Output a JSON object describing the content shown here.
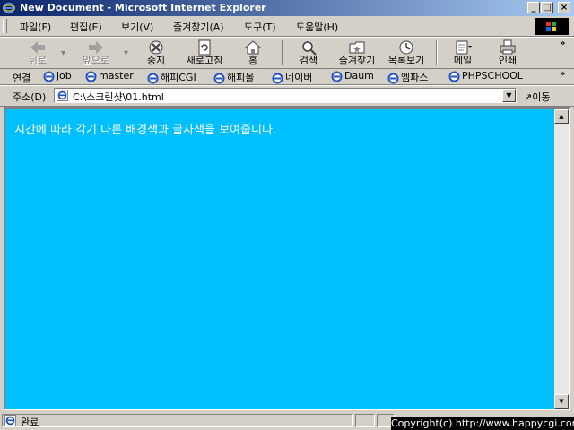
{
  "window": {
    "title": "New Document - Microsoft Internet Explorer"
  },
  "menu": [
    "파일(F)",
    "편집(E)",
    "보기(V)",
    "즐겨찾기(A)",
    "도구(T)",
    "도움말(H)"
  ],
  "toolbar": {
    "back": "뒤로",
    "forward": "앞으로",
    "stop": "중지",
    "refresh": "새로고침",
    "home": "홈",
    "search": "검색",
    "favorites": "즐겨찾기",
    "history": "목록보기",
    "mail": "메일",
    "print": "인쇄"
  },
  "links": {
    "label": "연결",
    "items": [
      "job",
      "master",
      "해피CGI",
      "해피몰",
      "네이버",
      "Daum",
      "엠파스",
      "PHPSCHOOL"
    ]
  },
  "address": {
    "label": "주소(D)",
    "url": "C:\\스크린샷\\01.html",
    "go": "이동"
  },
  "page": {
    "message": "시간에 따라 각기 다른 배경색과 글자색을 보여줍니다.",
    "background_color": "#00bfff",
    "text_color": "#ffffff"
  },
  "status": {
    "text": "완료"
  },
  "watermark": "Copyright(c) http://www.happycgi.com"
}
